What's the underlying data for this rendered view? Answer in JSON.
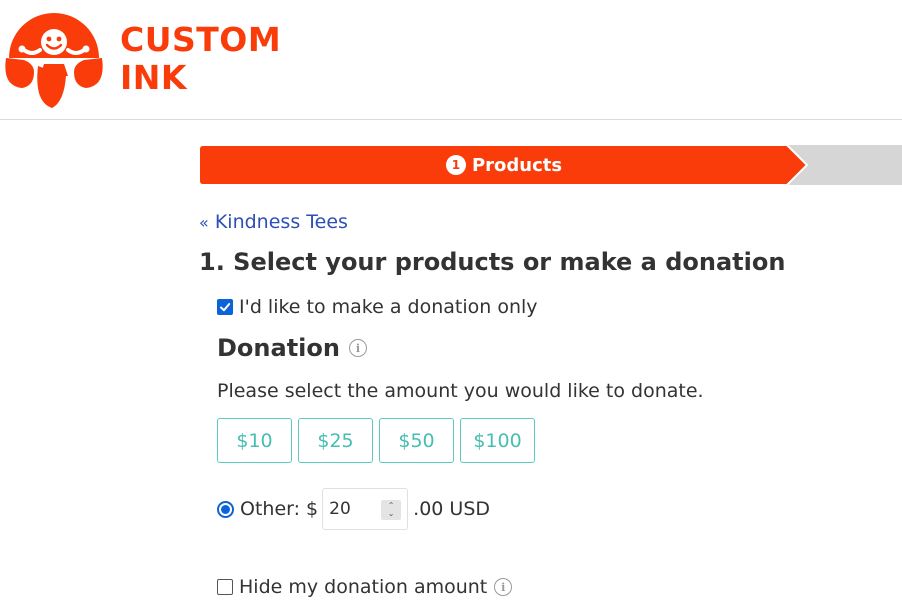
{
  "brand": {
    "line1": "CUSTOM",
    "line2": "INK",
    "color": "#f93c0a"
  },
  "progress": {
    "step_number": "1",
    "step_label": "Products",
    "active_color": "#f93c0a",
    "inactive_color": "#d6d6d6"
  },
  "nav": {
    "back_chevron": "«",
    "back_label": "Kindness Tees"
  },
  "section": {
    "title": "1. Select your products or make a donation"
  },
  "donation_only": {
    "label": "I'd like to make a donation only",
    "checked": true
  },
  "donation": {
    "title": "Donation",
    "info_icon": "info-icon",
    "description": "Please select the amount you would like to donate.",
    "amounts": [
      "$10",
      "$25",
      "$50",
      "$100"
    ],
    "other_label": "Other: $",
    "other_value": "20",
    "other_suffix": ".00 USD",
    "other_selected": true
  },
  "hide_amount": {
    "label": "Hide my donation amount",
    "checked": false
  },
  "colors": {
    "link": "#2d4fb8",
    "teal": "#48bdb3",
    "checkbox_blue": "#0b63d8"
  }
}
